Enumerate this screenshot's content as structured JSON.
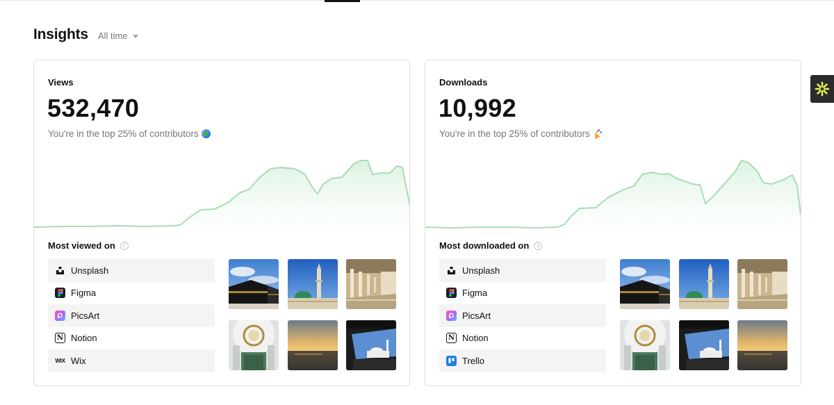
{
  "page": {
    "title": "Insights",
    "range_label": "All time"
  },
  "views": {
    "label": "Views",
    "value": "532,470",
    "note": "You're in the top 25% of contributors",
    "note_emoji_icon": "globe-icon",
    "list_title": "Most viewed on",
    "platforms": [
      {
        "label": "Unsplash",
        "icon": "unsplash-icon"
      },
      {
        "label": "Figma",
        "icon": "figma-icon"
      },
      {
        "label": "PicsArt",
        "icon": "picsart-icon"
      },
      {
        "label": "Notion",
        "icon": "notion-icon"
      },
      {
        "label": "Wix",
        "icon": "wix-icon"
      }
    ],
    "photos": [
      "kaaba-sky",
      "mosque-minaret-blue-sky",
      "arcade-corridor",
      "dome-chandelier",
      "sunset-sea",
      "car-window-mosque"
    ]
  },
  "downloads": {
    "label": "Downloads",
    "value": "10,992",
    "note": "You're in the top 25% of contributors",
    "note_emoji_icon": "party-popper-icon",
    "list_title": "Most downloaded on",
    "platforms": [
      {
        "label": "Unsplash",
        "icon": "unsplash-icon"
      },
      {
        "label": "Figma",
        "icon": "figma-icon"
      },
      {
        "label": "PicsArt",
        "icon": "picsart-icon"
      },
      {
        "label": "Notion",
        "icon": "notion-icon"
      },
      {
        "label": "Trello",
        "icon": "trello-icon"
      }
    ],
    "photos": [
      "kaaba-sky",
      "mosque-minaret-blue-sky",
      "arcade-corridor",
      "dome-chandelier",
      "car-window-mosque",
      "sunset-sea"
    ]
  },
  "colors": {
    "chart_line": "#a8dcb2",
    "chart_fill": "#e4f5e8"
  }
}
